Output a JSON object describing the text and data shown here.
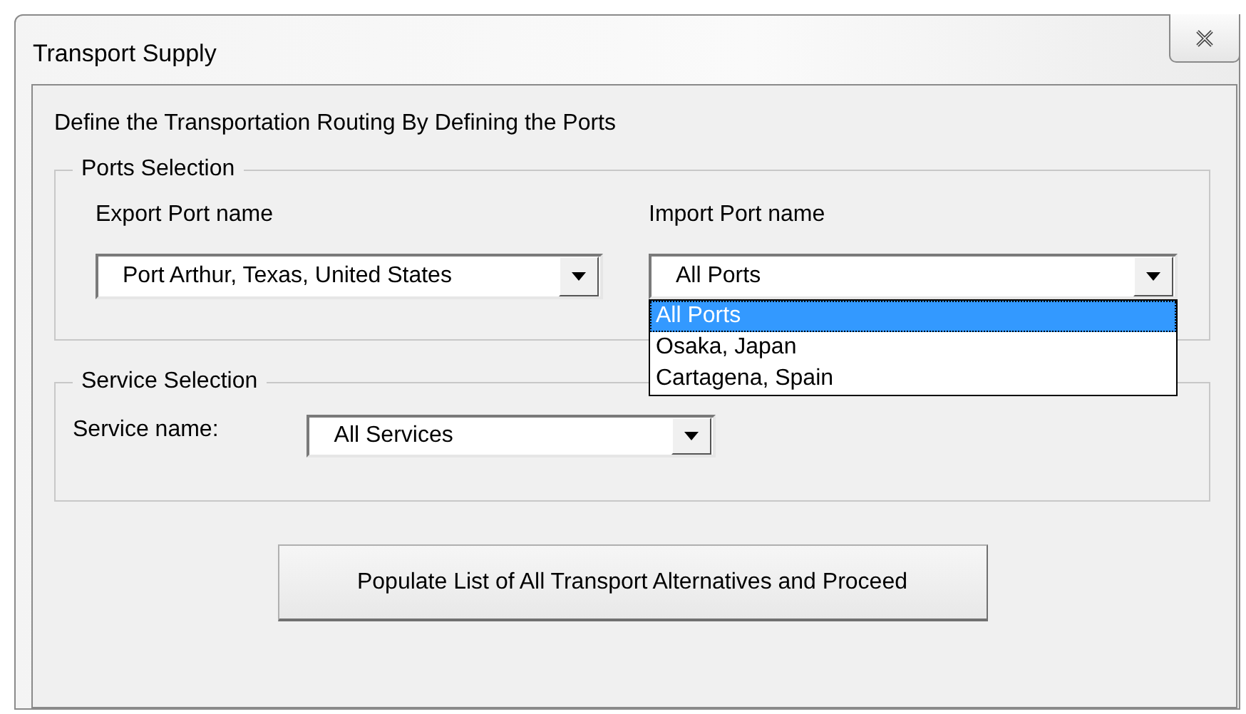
{
  "window": {
    "title": "Transport Supply"
  },
  "instruction": "Define the Transportation Routing By Defining the Ports",
  "ports_selection": {
    "legend": "Ports Selection",
    "export_port": {
      "label": "Export Port name",
      "value": "Port Arthur, Texas, United States"
    },
    "import_port": {
      "label": "Import Port name",
      "value": "All Ports",
      "expanded": true,
      "options": [
        {
          "label": "All Ports",
          "selected": true
        },
        {
          "label": "Osaka, Japan",
          "selected": false
        },
        {
          "label": "Cartagena, Spain",
          "selected": false
        }
      ]
    }
  },
  "service_selection": {
    "legend": "Service Selection",
    "label": "Service name:",
    "value": "All Services"
  },
  "buttons": [
    "Populate List of All Transport Alternatives and Proceed"
  ]
}
